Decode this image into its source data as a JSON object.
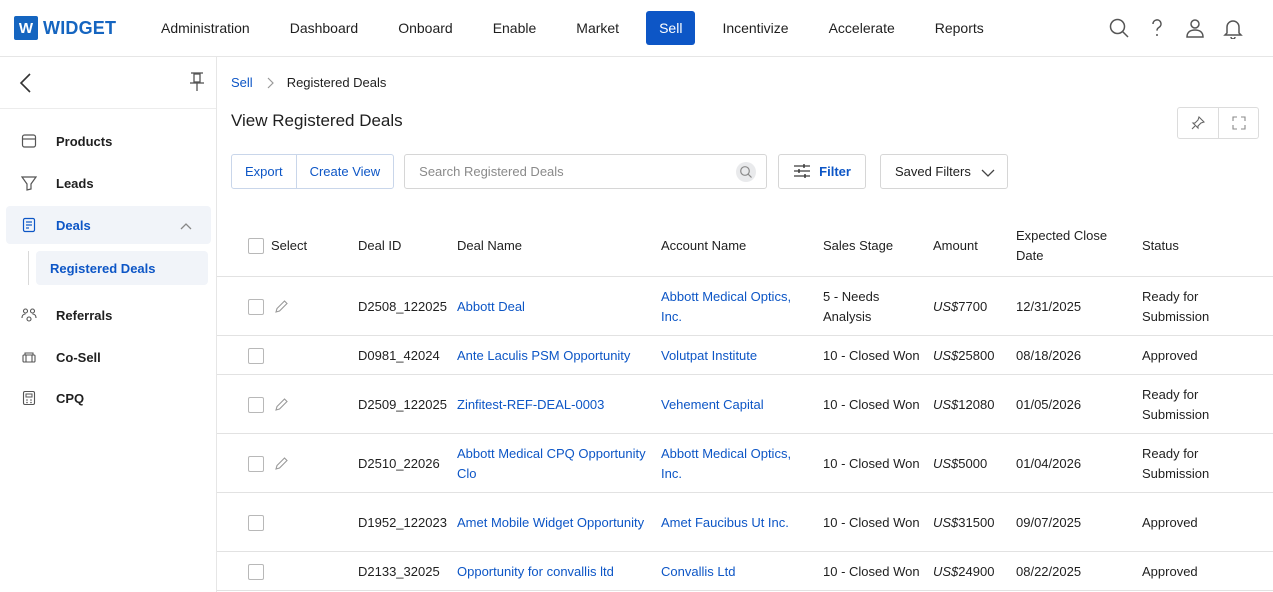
{
  "app": {
    "logo_letter": "W",
    "logo_text": "WIDGET"
  },
  "nav": {
    "items": [
      "Administration",
      "Dashboard",
      "Onboard",
      "Enable",
      "Market",
      "Sell",
      "Incentivize",
      "Accelerate",
      "Reports"
    ],
    "active": "Sell"
  },
  "sidebar": {
    "items": [
      "Products",
      "Leads",
      "Deals",
      "Referrals",
      "Co-Sell",
      "CPQ"
    ],
    "active": "Deals",
    "sub_item": "Registered Deals"
  },
  "breadcrumb": {
    "parent": "Sell",
    "current": "Registered Deals"
  },
  "page": {
    "title": "View Registered Deals"
  },
  "toolbar": {
    "export_label": "Export",
    "create_view_label": "Create View",
    "search_placeholder": "Search Registered Deals",
    "filter_label": "Filter",
    "saved_filters_label": "Saved Filters"
  },
  "table": {
    "headers": {
      "select": "Select",
      "deal_id": "Deal ID",
      "deal_name": "Deal Name",
      "account_name": "Account Name",
      "sales_stage": "Sales Stage",
      "amount": "Amount",
      "expected_close_date": "Expected Close Date",
      "status": "Status"
    },
    "rows": [
      {
        "deal_id": "D2508_122025",
        "deal_name": "Abbott Deal",
        "account_name": "Abbott Medical Optics, Inc.",
        "sales_stage": "5 - Needs Analysis",
        "currency": "US$",
        "amount": "7700",
        "close_date": "12/31/2025",
        "status": "Ready for Submission",
        "editable": true
      },
      {
        "deal_id": "D0981_42024",
        "deal_name": "Ante Laculis PSM Opportunity",
        "account_name": "Volutpat Institute",
        "sales_stage": "10 - Closed Won",
        "currency": "US$",
        "amount": "25800",
        "close_date": "08/18/2026",
        "status": "Approved",
        "editable": false
      },
      {
        "deal_id": "D2509_122025",
        "deal_name": "Zinfitest-REF-DEAL-0003",
        "account_name": "Vehement Capital",
        "sales_stage": "10 - Closed Won",
        "currency": "US$",
        "amount": "12080",
        "close_date": "01/05/2026",
        "status": "Ready for Submission",
        "editable": true
      },
      {
        "deal_id": "D2510_22026",
        "deal_name": "Abbott Medical CPQ Opportunity Clo",
        "account_name": "Abbott Medical Optics, Inc.",
        "sales_stage": "10 - Closed Won",
        "currency": "US$",
        "amount": "5000",
        "close_date": "01/04/2026",
        "status": "Ready for Submission",
        "editable": true
      },
      {
        "deal_id": "D1952_122023",
        "deal_name": "Amet Mobile Widget Opportunity",
        "account_name": "Amet Faucibus Ut Inc.",
        "sales_stage": "10 - Closed Won",
        "currency": "US$",
        "amount": "31500",
        "close_date": "09/07/2025",
        "status": "Approved",
        "editable": false
      },
      {
        "deal_id": "D2133_32025",
        "deal_name": "Opportunity for convallis ltd",
        "account_name": "Convallis Ltd",
        "sales_stage": "10 - Closed Won",
        "currency": "US$",
        "amount": "24900",
        "close_date": "08/22/2025",
        "status": "Approved",
        "editable": false
      }
    ]
  },
  "colors": {
    "accent": "#0d56c6",
    "logo": "#1565c0",
    "active_bg": "#f1f4f9"
  }
}
